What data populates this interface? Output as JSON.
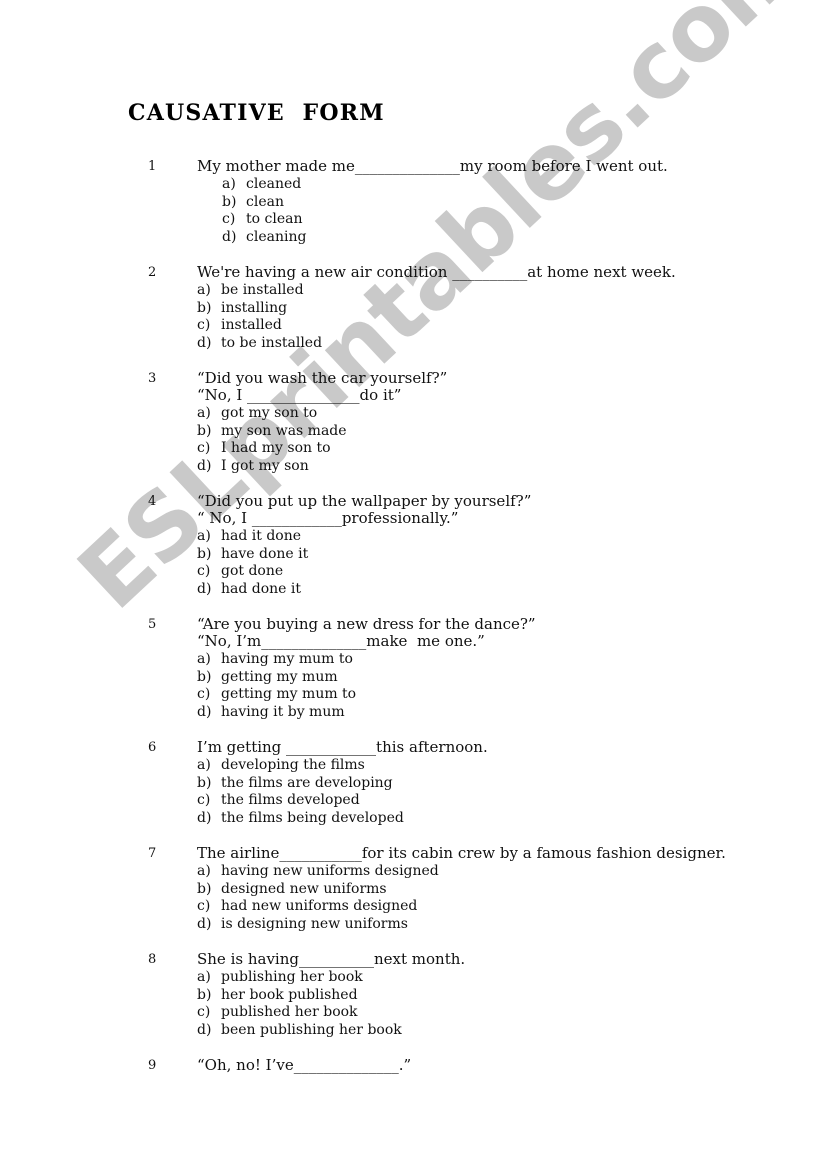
{
  "document": {
    "title": "CAUSATIVE  FORM",
    "watermark": "ESLprintables.com",
    "watermark_color": "#c9c9c9"
  },
  "questions": [
    {
      "number": "1",
      "lines": [
        "My mother made me______________my room before I went out."
      ],
      "indent": "deep",
      "options": [
        {
          "letter": "a)",
          "text": "cleaned"
        },
        {
          "letter": "b)",
          "text": "clean"
        },
        {
          "letter": "c)",
          "text": "to clean"
        },
        {
          "letter": "d)",
          "text": "cleaning"
        }
      ]
    },
    {
      "number": "2",
      "lines": [
        "We're having a new air condition __________at home next week."
      ],
      "indent": "normal",
      "options": [
        {
          "letter": "a)",
          "text": "be installed"
        },
        {
          "letter": "b)",
          "text": "installing"
        },
        {
          "letter": "c)",
          "text": "installed"
        },
        {
          "letter": "d)",
          "text": "to be installed"
        }
      ]
    },
    {
      "number": "3",
      "lines": [
        "“Did you wash the car yourself?”",
        "“No, I _______________do it”"
      ],
      "indent": "normal",
      "options": [
        {
          "letter": "a)",
          "text": "got my son to"
        },
        {
          "letter": "b)",
          "text": "my son was made"
        },
        {
          "letter": "c)",
          "text": "I had my son to"
        },
        {
          "letter": "d)",
          "text": "I got my son"
        }
      ]
    },
    {
      "number": "4",
      "lines": [
        "“Did you put up the wallpaper by yourself?”",
        "“ No, I ____________professionally.”"
      ],
      "indent": "normal",
      "options": [
        {
          "letter": "a)",
          "text": "had it done"
        },
        {
          "letter": "b)",
          "text": "have done it"
        },
        {
          "letter": "c)",
          "text": "got done"
        },
        {
          "letter": "d)",
          "text": "had done it"
        }
      ]
    },
    {
      "number": "5",
      "lines": [
        "“Are you buying a new dress for the dance?”",
        "“No, I’m______________make  me one.”"
      ],
      "indent": "normal",
      "options": [
        {
          "letter": "a)",
          "text": "having my mum to"
        },
        {
          "letter": "b)",
          "text": "getting my mum"
        },
        {
          "letter": "c)",
          "text": "getting my mum to"
        },
        {
          "letter": "d)",
          "text": "having it by mum"
        }
      ]
    },
    {
      "number": "6",
      "lines": [
        "I’m getting ____________this afternoon."
      ],
      "indent": "normal",
      "options": [
        {
          "letter": "a)",
          "text": "developing the films"
        },
        {
          "letter": "b)",
          "text": "the films are developing"
        },
        {
          "letter": "c)",
          "text": "the films developed"
        },
        {
          "letter": "d)",
          "text": "the films being developed"
        }
      ]
    },
    {
      "number": "7",
      "lines": [
        "The airline___________for its cabin crew by a famous fashion designer."
      ],
      "indent": "normal",
      "options": [
        {
          "letter": "a)",
          "text": "having new uniforms designed"
        },
        {
          "letter": "b)",
          "text": "designed new uniforms"
        },
        {
          "letter": "c)",
          "text": "had new uniforms designed"
        },
        {
          "letter": "d)",
          "text": "is designing new uniforms"
        }
      ]
    },
    {
      "number": "8",
      "lines": [
        "She is having__________next month."
      ],
      "indent": "normal",
      "options": [
        {
          "letter": "a)",
          "text": "publishing her book"
        },
        {
          "letter": "b)",
          "text": "her book published"
        },
        {
          "letter": "c)",
          "text": "published her book"
        },
        {
          "letter": "d)",
          "text": "been publishing her book"
        }
      ]
    },
    {
      "number": "9",
      "lines": [
        "“Oh, no! I’ve______________.”"
      ],
      "indent": "normal",
      "options": []
    }
  ]
}
